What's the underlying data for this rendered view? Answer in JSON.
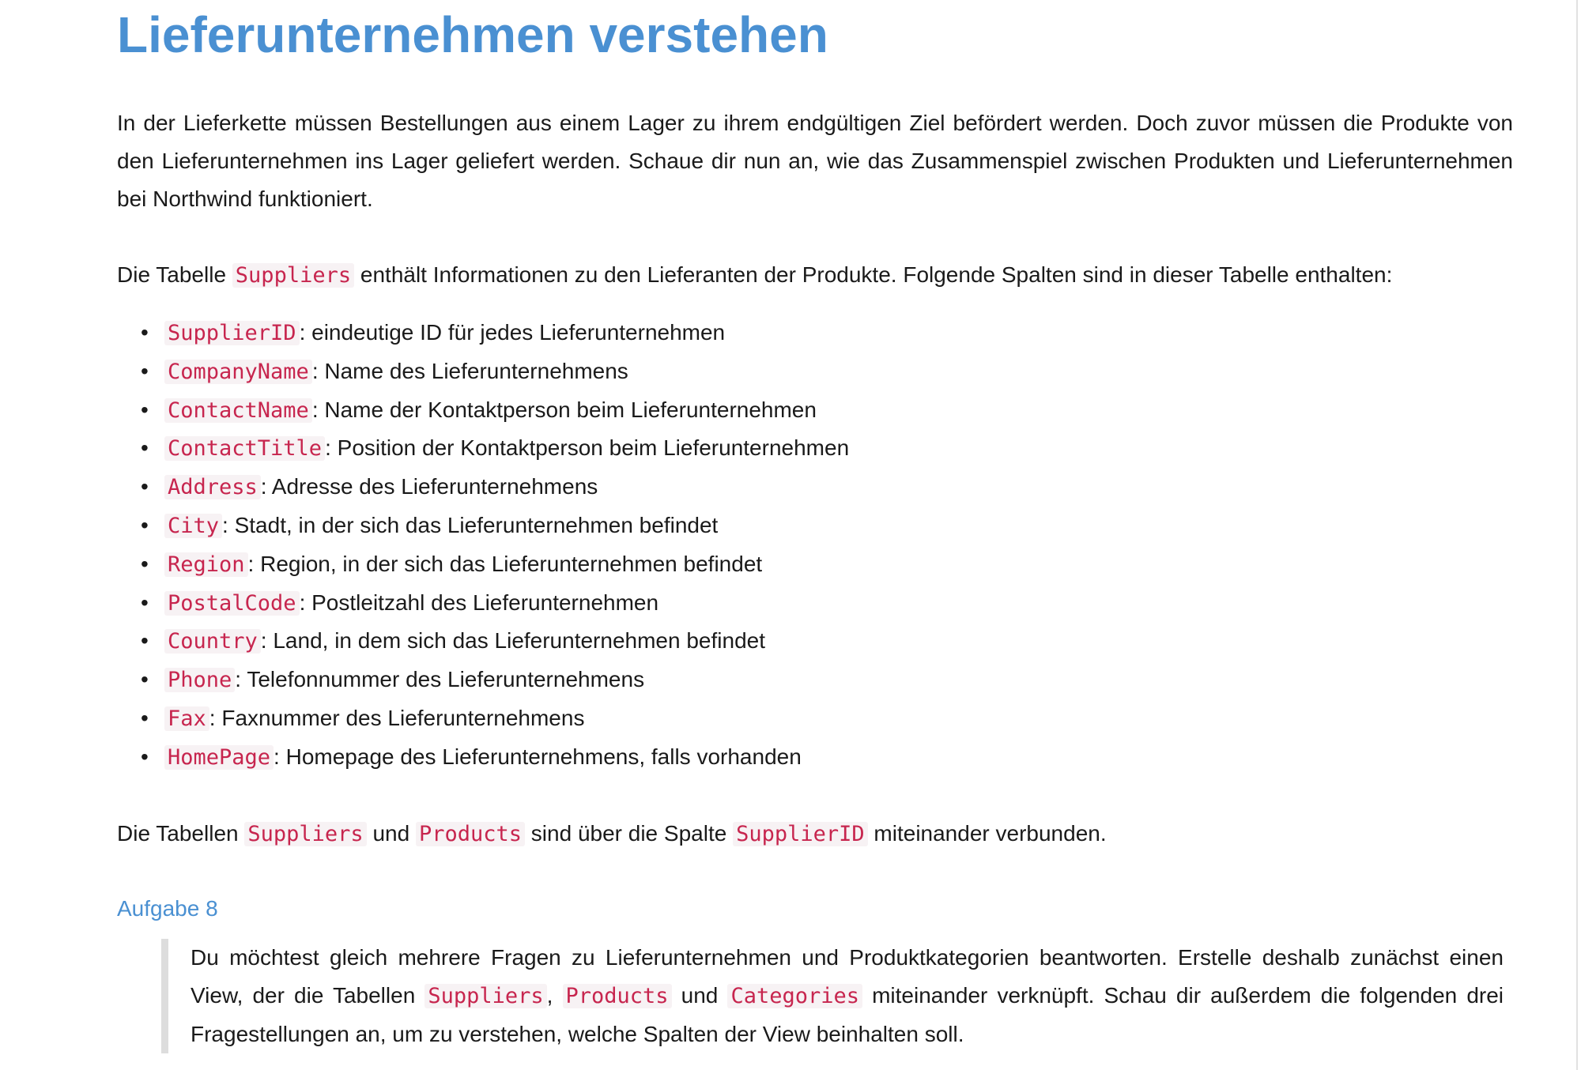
{
  "page": {
    "title": "Lieferunternehmen verstehen"
  },
  "intro": {
    "text": "In der Lieferkette müssen Bestellungen aus einem Lager zu ihrem endgültigen Ziel befördert werden. Doch zuvor müssen die Produkte von den Lieferunternehmen ins Lager geliefert werden. Schaue dir nun an, wie das Zusammenspiel zwischen Produkten und Lieferunternehmen bei Northwind funktioniert."
  },
  "suppliers_intro": {
    "before": "Die Tabelle ",
    "table": "Suppliers",
    "after": " enthält Informationen zu den Lieferanten der Produkte. Folgende Spalten sind in dieser Tabelle enthalten:"
  },
  "columns": [
    {
      "name": "SupplierID",
      "desc": ": eindeutige ID für jedes Lieferunternehmen"
    },
    {
      "name": "CompanyName",
      "desc": ": Name des Lieferunternehmens"
    },
    {
      "name": "ContactName",
      "desc": ": Name der Kontaktperson beim Lieferunternehmen"
    },
    {
      "name": "ContactTitle",
      "desc": ": Position der Kontaktperson beim Lieferunternehmen"
    },
    {
      "name": "Address",
      "desc": ": Adresse des Lieferunternehmens"
    },
    {
      "name": "City",
      "desc": ": Stadt, in der sich das Lieferunternehmen befindet"
    },
    {
      "name": "Region",
      "desc": ": Region, in der sich das Lieferunternehmen befindet"
    },
    {
      "name": "PostalCode",
      "desc": ": Postleitzahl des Lieferunternehmen"
    },
    {
      "name": "Country",
      "desc": ": Land, in dem sich das Lieferunternehmen befindet"
    },
    {
      "name": "Phone",
      "desc": ": Telefonnummer des Lieferunternehmens"
    },
    {
      "name": "Fax",
      "desc": ": Faxnummer des Lieferunternehmens"
    },
    {
      "name": "HomePage",
      "desc": ": Homepage des Lieferunternehmens, falls vorhanden"
    }
  ],
  "relation": {
    "t1": "Die Tabellen ",
    "code1": "Suppliers",
    "t2": " und ",
    "code2": "Products",
    "t3": " sind über die Spalte ",
    "code3": "SupplierID",
    "t4": " miteinander verbunden."
  },
  "task": {
    "heading": "Aufgabe 8",
    "t1": "Du möchtest gleich mehrere Fragen zu Lieferunternehmen und Produktkategorien beantworten. Erstelle deshalb zunächst einen View, der die Tabellen ",
    "code1": "Suppliers",
    "t2": ", ",
    "code2": "Products",
    "t3": " und ",
    "code3": "Categories",
    "t4": " miteinander verknüpft. Schau dir außerdem die folgenden drei Fragestellungen an, um zu verstehen, welche Spalten der View beinhalten soll."
  },
  "colors": {
    "heading": "#4a90d2",
    "code_text": "#c7254e",
    "code_bg": "#f7f2f4",
    "quote_border": "#dddddd"
  }
}
